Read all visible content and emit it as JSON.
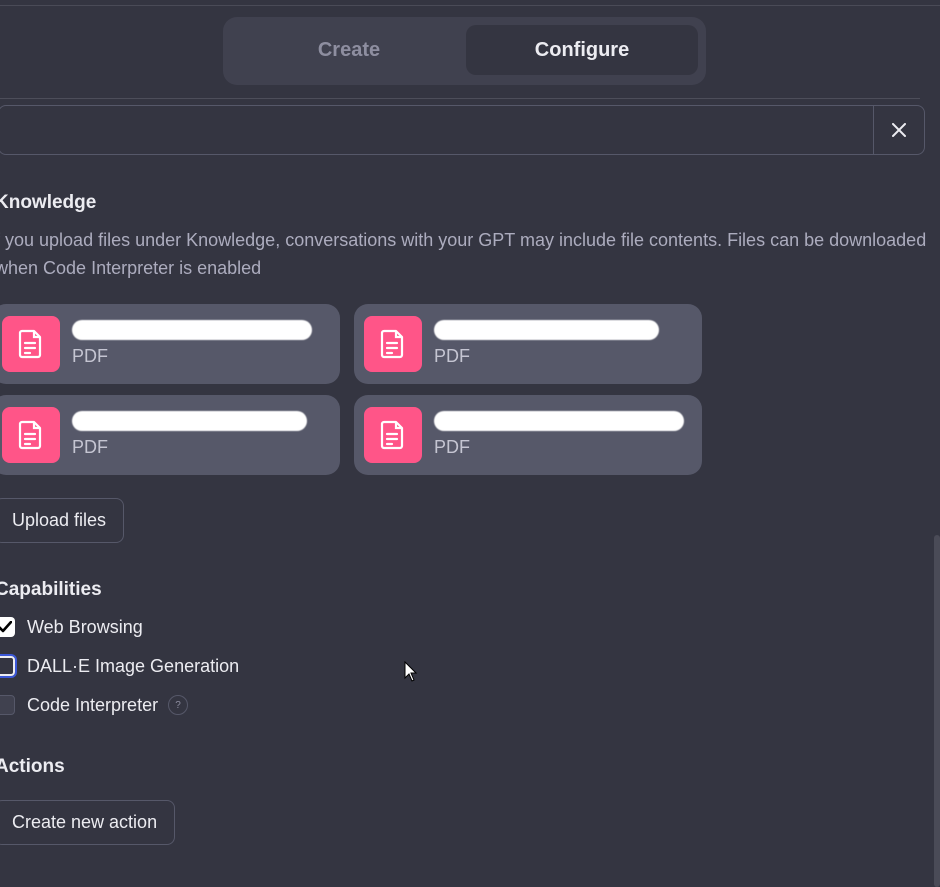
{
  "tabs": {
    "create": "Create",
    "configure": "Configure",
    "active": "configure"
  },
  "field": {
    "value": ""
  },
  "knowledge": {
    "title": "Knowledge",
    "description": "f you upload files under Knowledge, conversations with your GPT may include file contents. Files can be downloaded when Code Interpreter is enabled",
    "files": [
      {
        "type": "PDF"
      },
      {
        "type": "PDF"
      },
      {
        "type": "PDF"
      },
      {
        "type": "PDF"
      }
    ],
    "upload_label": "Upload files"
  },
  "capabilities": {
    "title": "Capabilities",
    "items": [
      {
        "label": "Web Browsing",
        "checked": true
      },
      {
        "label": "DALL·E Image Generation",
        "checked": false
      },
      {
        "label": "Code Interpreter",
        "checked": false,
        "help": "?"
      }
    ]
  },
  "actions": {
    "title": "Actions",
    "create_label": "Create new action"
  },
  "colors": {
    "background": "#343541",
    "file_icon": "#ff5588",
    "focus_ring": "#3b57d6"
  }
}
